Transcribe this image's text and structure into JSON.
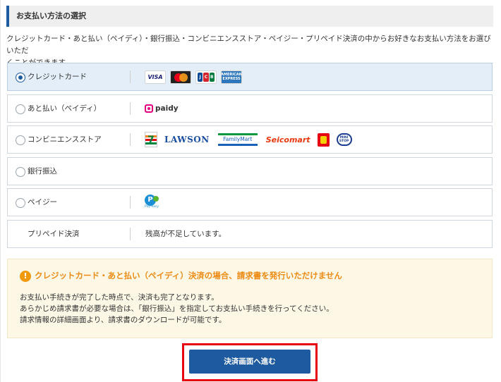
{
  "header": {
    "title": "お支払い方法の選択"
  },
  "intro_line1": "クレジットカード・あと払い（ペイディ）・銀行振込・コンビニエンスストア・ペイジー・プリペイド決済の中からお好きなお支払い方法をお選びいただ",
  "intro_line2": "くことができます。",
  "options": [
    {
      "label": "クレジットカード",
      "selected": true
    },
    {
      "label": "あと払い（ペイディ）",
      "selected": false
    },
    {
      "label": "コンビニエンスストア",
      "selected": false
    },
    {
      "label": "銀行振込",
      "selected": false
    },
    {
      "label": "ペイジー",
      "selected": false
    },
    {
      "label": "プリペイド決済",
      "note": "残高が不足しています。",
      "selected": false
    }
  ],
  "logos": {
    "visa": "VISA",
    "jcb": [
      "J",
      "C",
      "B"
    ],
    "amex_line1": "AMERICAN",
    "amex_line2": "EXPRESS",
    "paidy": "paidy",
    "seven": "7",
    "lawson": "LAWSON",
    "familymart": "FamilyMart",
    "seicomart": "Seicomart",
    "ministop_line1": "MINI",
    "ministop_line2": "STOP",
    "payeasy_mark": "P",
    "payeasy_text": "Pay-easy"
  },
  "warning": {
    "icon": "!",
    "title": "クレジットカード・あと払い（ペイディ）決済の場合、請求書を発行いただけません",
    "line1": "お支払い手続きが完了した時点で、決済も完了となります。",
    "line2": "あらかじめ請求書が必要な場合は、「銀行振込」を指定してお支払い手続きを行ってください。",
    "line3": "請求情報の詳細画面より、請求書のダウンロードが可能です。"
  },
  "submit_label": "決済画面へ進む",
  "colors": {
    "accent": "#1e5aa0",
    "warning": "#ec8a12",
    "highlight": "#e60012"
  }
}
